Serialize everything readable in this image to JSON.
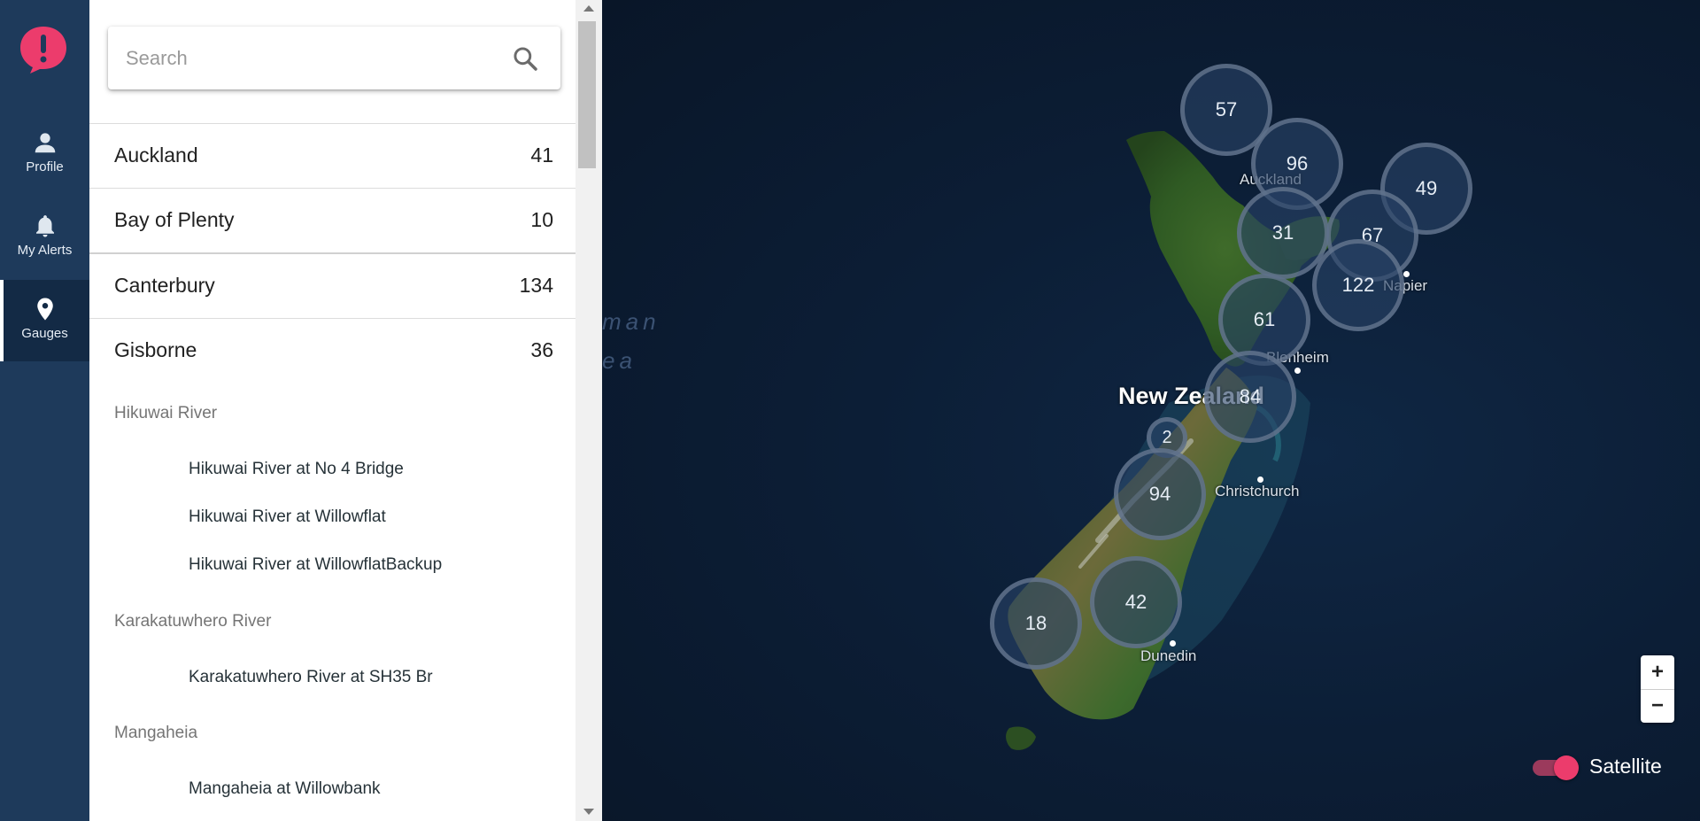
{
  "nav": {
    "logo_icon": "alert-bubble-icon",
    "items": [
      {
        "label": "Profile",
        "icon": "person-icon"
      },
      {
        "label": "My Alerts",
        "icon": "bell-icon"
      },
      {
        "label": "Gauges",
        "icon": "map-pin-icon"
      }
    ],
    "active": "Gauges"
  },
  "search": {
    "placeholder": "Search",
    "value": "",
    "icon": "search-icon"
  },
  "regions": [
    {
      "name": "Auckland",
      "count": "41"
    },
    {
      "name": "Bay of Plenty",
      "count": "10"
    },
    {
      "name": "Canterbury",
      "count": "134"
    },
    {
      "name": "Gisborne",
      "count": "36"
    }
  ],
  "rivers": [
    {
      "name": "Hikuwai River",
      "sites": [
        "Hikuwai River at No 4 Bridge",
        "Hikuwai River at Willowflat",
        "Hikuwai River at WillowflatBackup"
      ]
    },
    {
      "name": "Karakatuwhero River",
      "sites": [
        "Karakatuwhero River at SH35 Br"
      ]
    },
    {
      "name": "Mangaheia",
      "sites": [
        "Mangaheia at Willowbank"
      ]
    }
  ],
  "map": {
    "sea_label_line1": "man",
    "sea_label_line2": "ea",
    "country_label": "New Zealand",
    "cities": [
      "Auckland",
      "Napier",
      "Blenheim",
      "Christchurch",
      "Dunedin"
    ],
    "clusters": [
      "57",
      "96",
      "49",
      "31",
      "67",
      "122",
      "61",
      "84",
      "2",
      "94",
      "42",
      "18"
    ],
    "zoom_in": "+",
    "zoom_out": "−",
    "layer_toggle_label": "Satellite",
    "layer_toggle_on": true
  },
  "colors": {
    "nav_bg": "#1e3a5b",
    "accent": "#ec3c6c",
    "map_sea": "#0c1e36"
  }
}
